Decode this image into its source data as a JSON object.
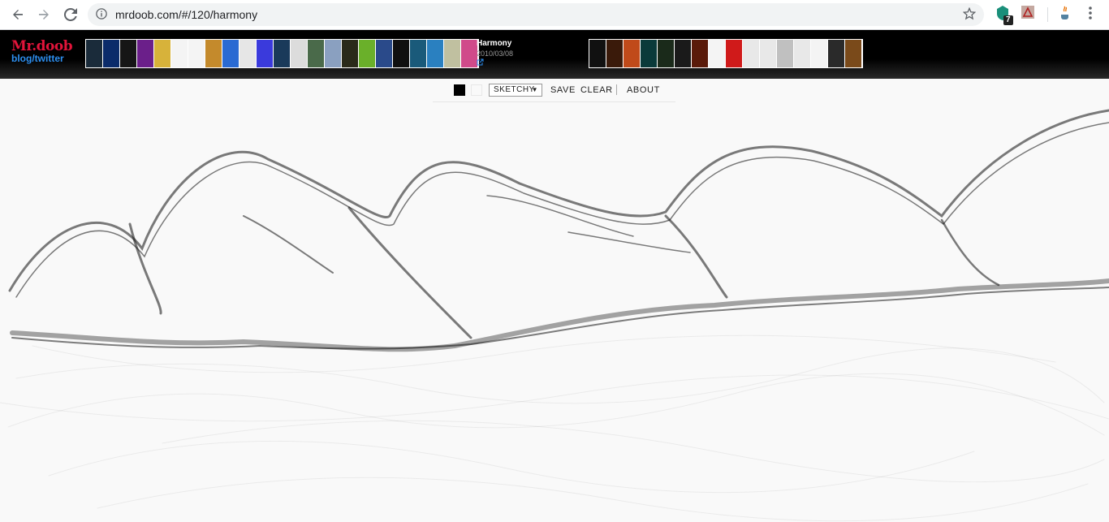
{
  "browser": {
    "url": "mrdoob.com/#/120/harmony",
    "extension_badge": "7"
  },
  "header": {
    "logo_line1": "Mr.doob",
    "logo_line2": "blog/twitter",
    "project": {
      "title": "Harmony",
      "date": "2010/03/08"
    },
    "thumbs_left_colors": [
      "#1a2b3a",
      "#0b2b6a",
      "#161616",
      "#6b1f8a",
      "#d7b23a",
      "#f4f4f4",
      "#f4f4f4",
      "#c48a2c",
      "#2a6ad2",
      "#e6e6e6",
      "#3a3adc",
      "#1a3a5a",
      "#dcdcdc",
      "#4a6a4a",
      "#8aa0c0",
      "#2a2a1a",
      "#6ab02a",
      "#2a4a8a",
      "#101010",
      "#1a5a7a",
      "#2a80c0",
      "#c0c0a0",
      "#d04a8a"
    ],
    "thumbs_right_colors": [
      "#111111",
      "#3a1a0a",
      "#c04a1a",
      "#0a3a3a",
      "#1a2a1a",
      "#1a1a1a",
      "#5a1a0a",
      "#f4f4f4",
      "#d01a1a",
      "#e8e8e8",
      "#e8e8e8",
      "#c0c0c0",
      "#e8e8e8",
      "#f4f4f4",
      "#2a2a2a",
      "#7a4a1a"
    ]
  },
  "toolbar": {
    "brush": "SKETCHY",
    "dropdown_arrow": "▼",
    "save_label": "SAVE",
    "clear_label": "CLEAR",
    "about_label": "ABOUT",
    "fg_color": "#000000",
    "bg_color": "#f9f9f9"
  }
}
